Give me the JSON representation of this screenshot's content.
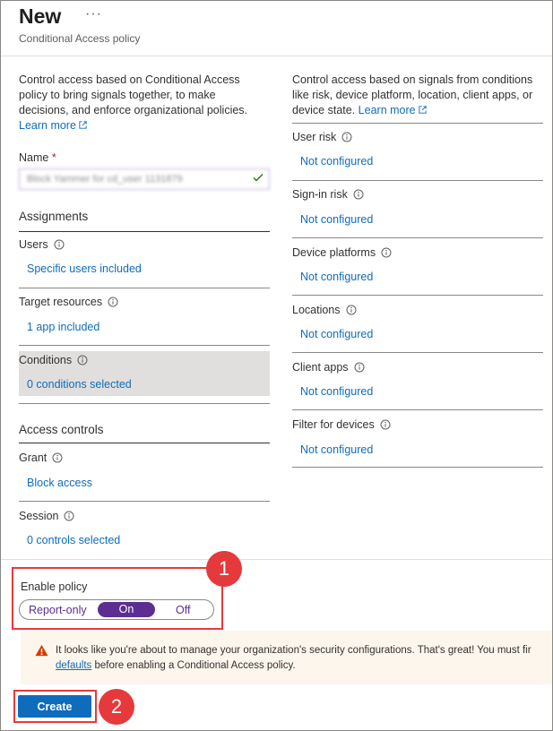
{
  "header": {
    "title": "New",
    "more": "···",
    "subtitle": "Conditional Access policy"
  },
  "left": {
    "intro": "Control access based on Conditional Access policy to bring signals together, to make decisions, and enforce organizational policies.",
    "learn_more": "Learn more",
    "name_label": "Name",
    "name_required": "*",
    "name_value": "Block Yammer for cd_user 1131879",
    "assignments_heading": "Assignments",
    "users_label": "Users",
    "users_value": "Specific users included",
    "targets_label": "Target resources",
    "targets_value": "1 app included",
    "conditions_label": "Conditions",
    "conditions_value": "0 conditions selected",
    "access_heading": "Access controls",
    "grant_label": "Grant",
    "grant_value": "Block access",
    "session_label": "Session",
    "session_value": "0 controls selected"
  },
  "right": {
    "intro": "Control access based on signals from conditions like risk, device platform, location, client apps, or device state.",
    "learn_more": "Learn more",
    "conditions": [
      {
        "label": "User risk",
        "value": "Not configured"
      },
      {
        "label": "Sign-in risk",
        "value": "Not configured"
      },
      {
        "label": "Device platforms",
        "value": "Not configured"
      },
      {
        "label": "Locations",
        "value": "Not configured"
      },
      {
        "label": "Client apps",
        "value": "Not configured"
      },
      {
        "label": "Filter for devices",
        "value": "Not configured"
      }
    ]
  },
  "enable_policy": {
    "label": "Enable policy",
    "options": [
      "Report-only",
      "On",
      "Off"
    ],
    "selected": "On"
  },
  "warning": {
    "line1": "It looks like you're about to manage your organization's security configurations. That's great! You must fir",
    "line2_link": "defaults",
    "line2_rest": " before enabling a Conditional Access policy."
  },
  "create_label": "Create",
  "callouts": [
    "1",
    "2"
  ],
  "colors": {
    "accent": "#0f6cbd",
    "toggle": "#5c2e91",
    "callout": "#e6393b",
    "warning_bg": "#fdf6ed"
  }
}
